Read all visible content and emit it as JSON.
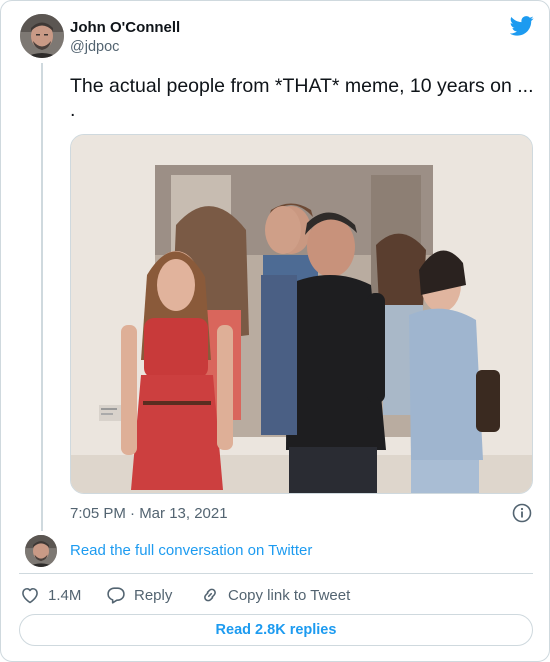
{
  "author": {
    "name": "John O'Connell",
    "handle": "@jdpoc"
  },
  "tweet": {
    "text": "The actual people from *THAT* meme, 10 years on ...\n.",
    "timestamp": "7:05 PM · Mar 13, 2021"
  },
  "conversation": {
    "read_label": "Read the full conversation on Twitter"
  },
  "actions": {
    "likes_count": "1.4M",
    "reply_label": "Reply",
    "copy_label": "Copy link to Tweet"
  },
  "replies": {
    "button_label": "Read 2.8K replies"
  },
  "icons": {
    "brand": "twitter-bird-icon",
    "info": "info-icon",
    "like": "heart-icon",
    "reply": "speech-bubble-icon",
    "copy": "link-icon"
  },
  "colors": {
    "accent": "#1d9bf0",
    "text": "#0f1419",
    "secondary": "#536471",
    "border": "#cfd9de"
  }
}
